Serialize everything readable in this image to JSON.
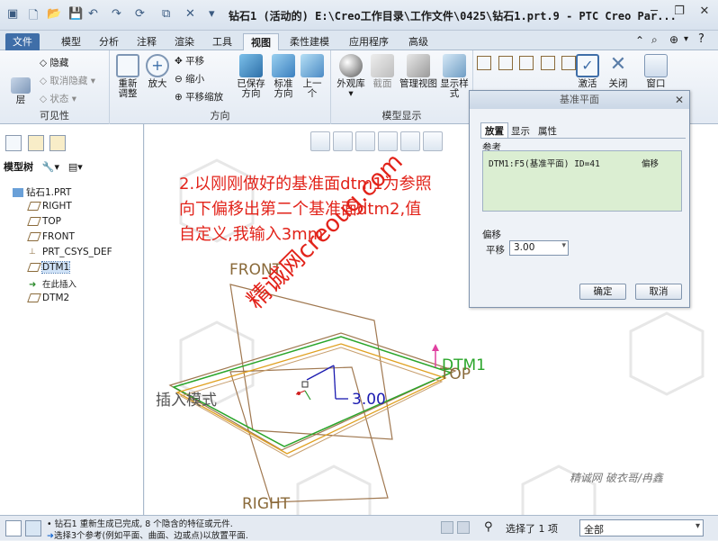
{
  "window": {
    "title": "钻石1 (活动的) E:\\Creo工作目录\\工作文件\\0425\\钻石1.prt.9 - PTC Creo Par..."
  },
  "tabs": [
    "文件",
    "模型",
    "分析",
    "注释",
    "渲染",
    "工具",
    "视图",
    "柔性建模",
    "应用程序",
    "高级"
  ],
  "active_tab": "视图",
  "ribbon": {
    "visibility": {
      "group_label": "可见性",
      "layer": "层",
      "hide": "隐藏",
      "unhide": "取消隐藏",
      "status": "状态"
    },
    "orientation": {
      "group_label": "方向",
      "refit": "重新\n调整",
      "zoom_in": "放大",
      "pan": "平移",
      "zoom_out": "缩小",
      "pan_zoom": "平移缩放",
      "saved_views": "已保存\n方向",
      "standard": "标准\n方向",
      "previous": "上一\n个"
    },
    "model_display": {
      "group_label": "模型显示",
      "appearance": "外观库",
      "section": "截面",
      "manage_views": "管理视图",
      "display_style": "显示样\n式"
    },
    "right": {
      "activate": "激活",
      "close": "关闭",
      "window": "窗口"
    }
  },
  "model_tree": {
    "header": "模型树",
    "items": [
      "钻石1.PRT",
      "RIGHT",
      "TOP",
      "FRONT",
      "PRT_CSYS_DEF",
      "DTM1",
      "在此插入",
      "DTM2"
    ],
    "selected": "DTM1"
  },
  "graphics": {
    "annotation_lines": [
      "2.以刚刚做好的基准面dtm1为参照",
      "向下偏移出第二个基准面dtm2,值",
      "自定义,我输入3mm"
    ],
    "labels": {
      "front": "FRONT",
      "right": "RIGHT",
      "top": "TOP",
      "dtm1": "DTM1",
      "offset_value": "3.00",
      "insert_mode": "插入模式"
    },
    "watermark_url": "精诚网creoug.com",
    "credit": "精诚网 破衣哥/冉鑫"
  },
  "dialog": {
    "title": "基准平面",
    "tabs": [
      "放置",
      "显示",
      "属性"
    ],
    "active_tab": "放置",
    "references_label": "参考",
    "reference_row": {
      "ref": "DTM1:F5(基准平面) ID=41",
      "constraint": "偏移"
    },
    "offset_label": "偏移",
    "translate_label": "平移",
    "translate_value": "3.00",
    "ok": "确定",
    "cancel": "取消"
  },
  "statusbar": {
    "messages": [
      "钻石1 重新生成已完成, 8 个隐含的特征或元件.",
      "选择3个参考(例如平面、曲面、边或点)以放置平面."
    ],
    "selection_count": "选择了 1 项",
    "filter": "全部"
  },
  "colors": {
    "annotation_red": "#e2231a",
    "dtm_green": "#2aa52a",
    "dim_blue": "#1a1ab0",
    "plane_brown": "#a07850"
  }
}
